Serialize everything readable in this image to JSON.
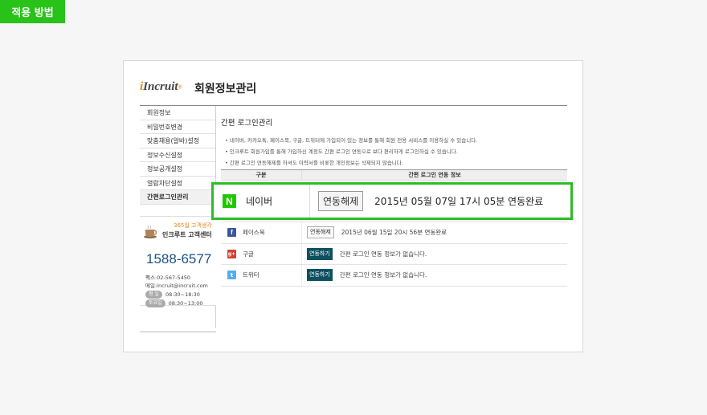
{
  "tag_label": "적용 방법",
  "header": {
    "logo": "Incruit",
    "title": "회원정보관리"
  },
  "sidebar": {
    "items": [
      {
        "label": "회원정보"
      },
      {
        "label": "비밀번호변경"
      },
      {
        "label": "맞춤채용(알바)설정"
      },
      {
        "label": "정보수신설정"
      },
      {
        "label": "정보공개설정"
      },
      {
        "label": "열람차단설정"
      },
      {
        "label": "간편로그인관리",
        "active": true
      }
    ]
  },
  "customer_center": {
    "tag": "365일 고객생각",
    "title": "인크루트 고객센터",
    "phone": "1588-6577",
    "fax": "팩스:02-567-5450",
    "email": "메일:incruit@incruit.com",
    "hours": [
      {
        "label": "평 일",
        "time": "08:30~18:30"
      },
      {
        "label": "토요일",
        "time": "08:30~13:00"
      }
    ]
  },
  "main": {
    "section_title": "간편 로그인관리",
    "notes": [
      "• 네이버, 카카오톡, 페이스북, 구글, 트위터에 가입되어 있는 정보를 통해 회원 전용 서비스를 이용하실 수 있습니다.",
      "• 인크루트 회원가입를 통해 가입하신 계정도 간편 로그인 연동으로 보다 편리하게 로그인하실 수 있습니다.",
      "• 간편 로그인 연동해제를 하셔도 이력서를 비롯한 개인정보는 삭제되지 않습니다."
    ],
    "table": {
      "headers": [
        "구분",
        "간편 로그인 연동 정보"
      ],
      "rows": [
        {
          "icon": "facebook-icon",
          "glyph": "f",
          "name": "페이스북",
          "button": "연동해제",
          "status": "2015년 06월 15일 20시 56분 연동완료",
          "style": "light"
        },
        {
          "icon": "google-plus-icon",
          "glyph": "g+",
          "name": "구글",
          "button": "연동하기",
          "status": "간편 로그인 연동 정보가 없습니다.",
          "style": "dark"
        },
        {
          "icon": "twitter-icon",
          "glyph": "t",
          "name": "트위터",
          "button": "연동하기",
          "status": "간편 로그인 연동 정보가 없습니다.",
          "style": "dark"
        }
      ]
    }
  },
  "highlight": {
    "icon": "naver-icon",
    "glyph": "N",
    "name": "네이버",
    "button": "연동해제",
    "status": "2015년 05월 07일 17시 05분 연동완료",
    "border_color": "#2cbd26"
  }
}
